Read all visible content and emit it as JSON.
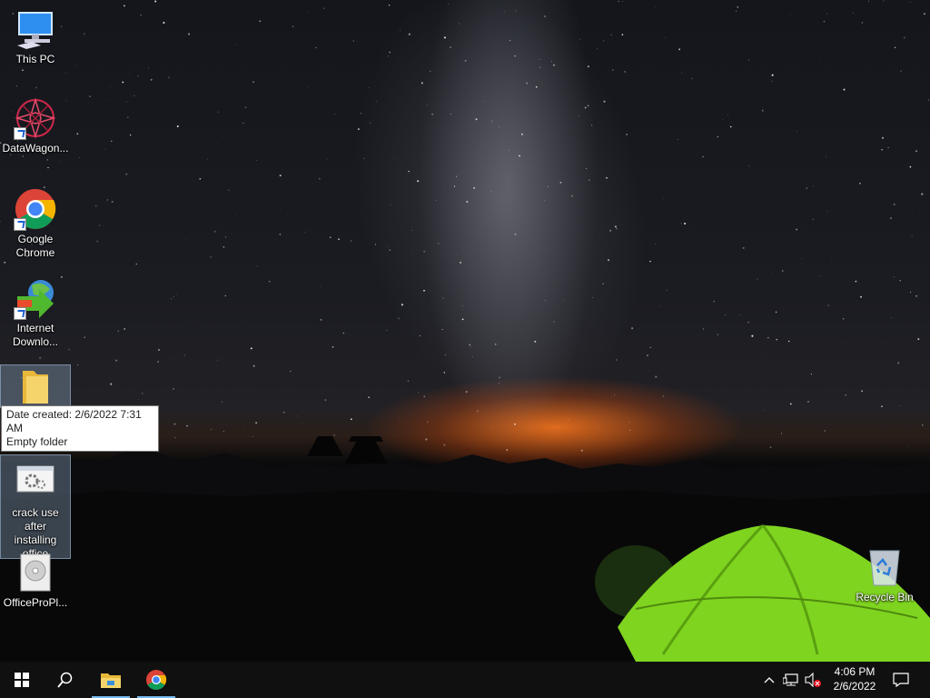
{
  "desktop": {
    "icons": [
      {
        "label": "This PC",
        "icon": "this-pc-icon"
      },
      {
        "label": "DataWagon...",
        "icon": "datawagon-icon"
      },
      {
        "label": "Google Chrome",
        "icon": "chrome-icon"
      },
      {
        "label": "Internet Downlo...",
        "icon": "internet-download-manager-icon"
      },
      {
        "label": "",
        "icon": "folder-icon"
      },
      {
        "label": "crack use after installing office",
        "icon": "settings-file-icon"
      },
      {
        "label": "OfficeProPl...",
        "icon": "disc-image-icon"
      },
      {
        "label": "Recycle Bin",
        "icon": "recycle-bin-icon"
      }
    ],
    "tooltip": {
      "line1": "Date created: 2/6/2022 7:31 AM",
      "line2": "Empty folder"
    }
  },
  "taskbar": {
    "start": "start-icon",
    "search": "search-icon",
    "pinned": [
      "file-explorer-icon",
      "chrome-icon"
    ],
    "tray": {
      "icons": [
        "chevron-up-icon",
        "network-icon",
        "volume-muted-icon",
        "notification-icon"
      ],
      "time": "4:06 PM",
      "date": "2/6/2022"
    }
  },
  "colors": {
    "taskbar": "#101010",
    "accent": "#76b9ed",
    "selection": "#99b4d1",
    "tent": "#8ee02a"
  }
}
